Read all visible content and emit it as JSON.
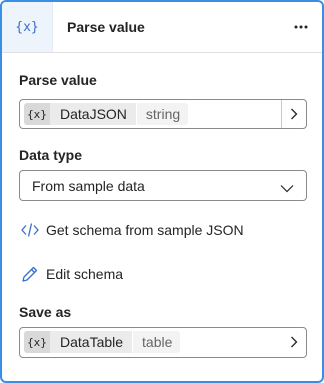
{
  "header": {
    "icon_glyph": "{x}",
    "title": "Parse value",
    "more_glyph": "⋯"
  },
  "parse_value": {
    "label": "Parse value",
    "token_icon": "{x}",
    "variable_name": "DataJSON",
    "variable_type": "string"
  },
  "data_type": {
    "label": "Data type",
    "selected": "From sample data"
  },
  "actions": {
    "get_schema": "Get schema from sample JSON",
    "edit_schema": "Edit schema"
  },
  "save_as": {
    "label": "Save as",
    "token_icon": "{x}",
    "variable_name": "DataTable",
    "variable_type": "table"
  },
  "colors": {
    "accent": "#3a8ee6",
    "icon_blue": "#3a6ec9"
  }
}
